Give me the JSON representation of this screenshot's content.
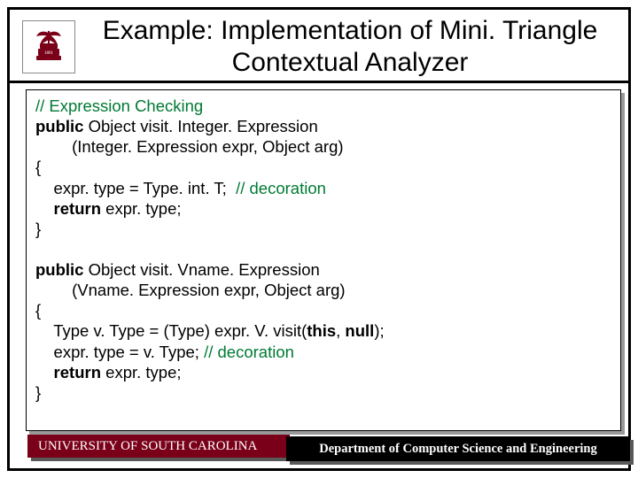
{
  "title": "Example: Implementation of Mini. Triangle Contextual Analyzer",
  "code": {
    "c1": "// Expression Checking",
    "kw_public1": "public",
    "l2a": " Object visit. Integer. Expression",
    "l3": "        (Integer. Expression expr, Object arg)",
    "l4": "{",
    "l5a": "    expr. type = Type. int. T;  ",
    "c5": "// decoration",
    "kw_return1": "    return",
    "l6a": " expr. type;",
    "l7": "}",
    "blank": " ",
    "kw_public2": "public",
    "l8a": " Object visit. Vname. Expression",
    "l9": "        (Vname. Expression expr, Object arg)",
    "l10": "{",
    "l11a": "    Type v. Type = (Type) expr. V. visit(",
    "kw_this": "this",
    "l11b": ", ",
    "kw_null": "null",
    "l11c": ");",
    "l12a": "    expr. type = v. Type; ",
    "c12": "// decoration",
    "kw_return2": "    return",
    "l13a": " expr. type;",
    "l14": "}"
  },
  "footer": {
    "left": "UNIVERSITY OF SOUTH CAROLINA",
    "right": "Department of Computer Science and Engineering"
  }
}
